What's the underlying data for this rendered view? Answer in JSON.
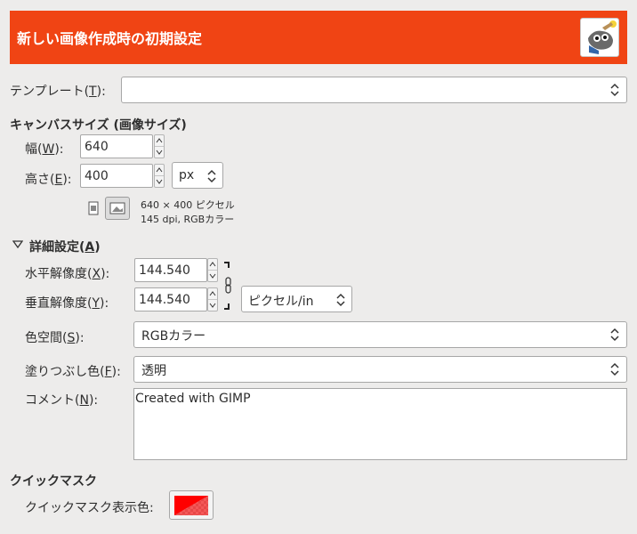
{
  "header": {
    "title": "新しい画像作成時の初期設定",
    "background": "#f04414"
  },
  "template": {
    "label_pre": "テンプレート(",
    "label_key": "T",
    "label_post": "):",
    "value": ""
  },
  "canvas_size": {
    "heading": "キャンバスサイズ (画像サイズ)",
    "width": {
      "label_pre": "幅(",
      "label_key": "W",
      "label_post": "):",
      "value": "640"
    },
    "height": {
      "label_pre": "高さ(",
      "label_key": "E",
      "label_post": "):",
      "value": "400"
    },
    "unit": "px",
    "info_line1": "640 × 400 ピクセル",
    "info_line2": "145 dpi, RGBカラー"
  },
  "advanced": {
    "heading_pre": "詳細設定(",
    "heading_key": "A",
    "heading_post": ")",
    "expander_icon": "triangle-down-icon",
    "x_resolution": {
      "label_pre": "水平解像度(",
      "label_key": "X",
      "label_post": "):",
      "value": "144.540"
    },
    "y_resolution": {
      "label_pre": "垂直解像度(",
      "label_key": "Y",
      "label_post": "):",
      "value": "144.540"
    },
    "resolution_unit": "ピクセル/in",
    "color_space": {
      "label_pre": "色空間(",
      "label_key": "S",
      "label_post": "):",
      "value": "RGBカラー"
    },
    "fill": {
      "label_pre": "塗りつぶし色(",
      "label_key": "F",
      "label_post": "):",
      "value": "透明"
    },
    "comment": {
      "label_pre": "コメント(",
      "label_key": "N",
      "label_post": "):",
      "value": "Created with GIMP"
    }
  },
  "quick_mask": {
    "heading": "クイックマスク",
    "color_label": "クイックマスク表示色:",
    "color": "#ff0000"
  }
}
